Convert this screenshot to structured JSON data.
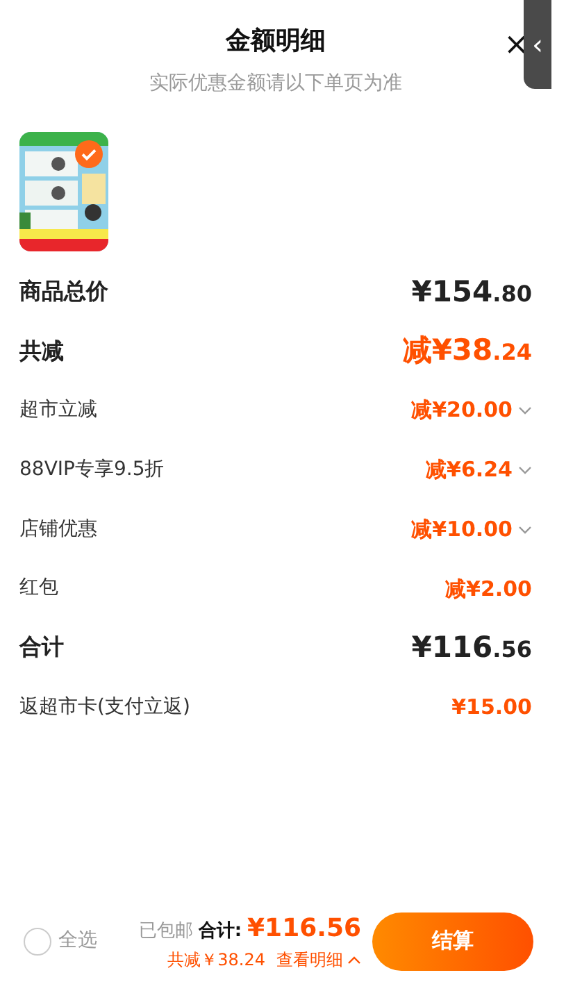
{
  "header": {
    "title": "金额明细",
    "subtitle": "实际优惠金额请以下单页为准",
    "close": "×"
  },
  "side_tab": {
    "glyph": "‹"
  },
  "product": {
    "selected": true
  },
  "rows": [
    {
      "kind": "summary",
      "label": "商品总价",
      "prefix": "",
      "amount": "¥154",
      "decimal": ".80",
      "highlight": false,
      "expandable": false
    },
    {
      "kind": "summary",
      "label": "共减",
      "prefix": "减",
      "amount": "¥38",
      "decimal": ".24",
      "highlight": true,
      "expandable": false
    },
    {
      "kind": "item",
      "label": "超市立减",
      "prefix": "减",
      "amount": "¥20.00",
      "decimal": "",
      "highlight": true,
      "expandable": true
    },
    {
      "kind": "item",
      "label": "88VIP专享9.5折",
      "prefix": "减",
      "amount": "¥6.24",
      "decimal": "",
      "highlight": true,
      "expandable": true
    },
    {
      "kind": "item",
      "label": "店铺优惠",
      "prefix": "减",
      "amount": "¥10.00",
      "decimal": "",
      "highlight": true,
      "expandable": true
    },
    {
      "kind": "item",
      "label": "红包",
      "prefix": "减",
      "amount": "¥2.00",
      "decimal": "",
      "highlight": true,
      "expandable": false
    },
    {
      "kind": "summary",
      "label": "合计",
      "prefix": "",
      "amount": "¥116",
      "decimal": ".56",
      "highlight": false,
      "expandable": false
    },
    {
      "kind": "item",
      "label": "返超市卡(支付立返)",
      "prefix": "",
      "amount": "¥15.00",
      "decimal": "",
      "highlight": true,
      "expandable": false
    }
  ],
  "footer": {
    "select_all": {
      "label": "全选",
      "checked": false
    },
    "shipping": "已包邮",
    "total_label": "合计:",
    "total": "¥116.56",
    "saving": "共减￥38.24",
    "details_link": "查看明细",
    "checkout": "结算"
  }
}
